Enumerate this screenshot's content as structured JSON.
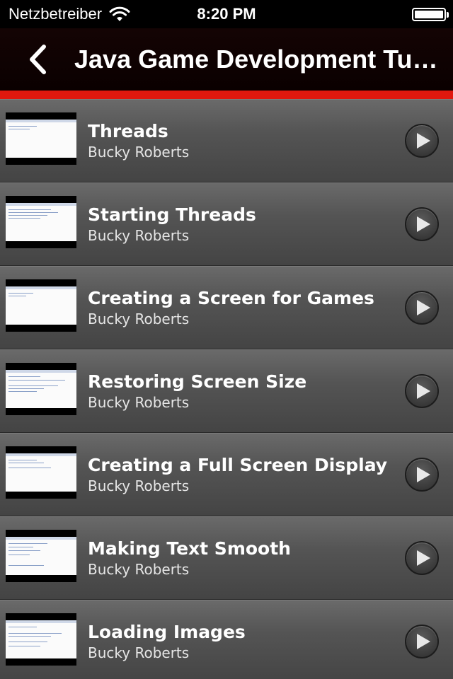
{
  "status_bar": {
    "carrier": "Netzbetreiber",
    "time": "8:20 PM",
    "icons": [
      "wifi-icon",
      "battery-icon"
    ]
  },
  "nav": {
    "title": "Java Game Development Tutorials",
    "back_icon": "chevron-left-icon"
  },
  "colors": {
    "accent": "#e0180e",
    "nav_bg": "#0f0202",
    "row_bg": "#555555"
  },
  "videos": [
    {
      "title": "Threads",
      "author": "Bucky Roberts"
    },
    {
      "title": "Starting Threads",
      "author": "Bucky Roberts"
    },
    {
      "title": "Creating a Screen for Games",
      "author": "Bucky Roberts"
    },
    {
      "title": "Restoring Screen Size",
      "author": "Bucky Roberts"
    },
    {
      "title": "Creating a Full Screen Display",
      "author": "Bucky Roberts"
    },
    {
      "title": "Making Text Smooth",
      "author": "Bucky Roberts"
    },
    {
      "title": "Loading Images",
      "author": "Bucky Roberts"
    }
  ]
}
